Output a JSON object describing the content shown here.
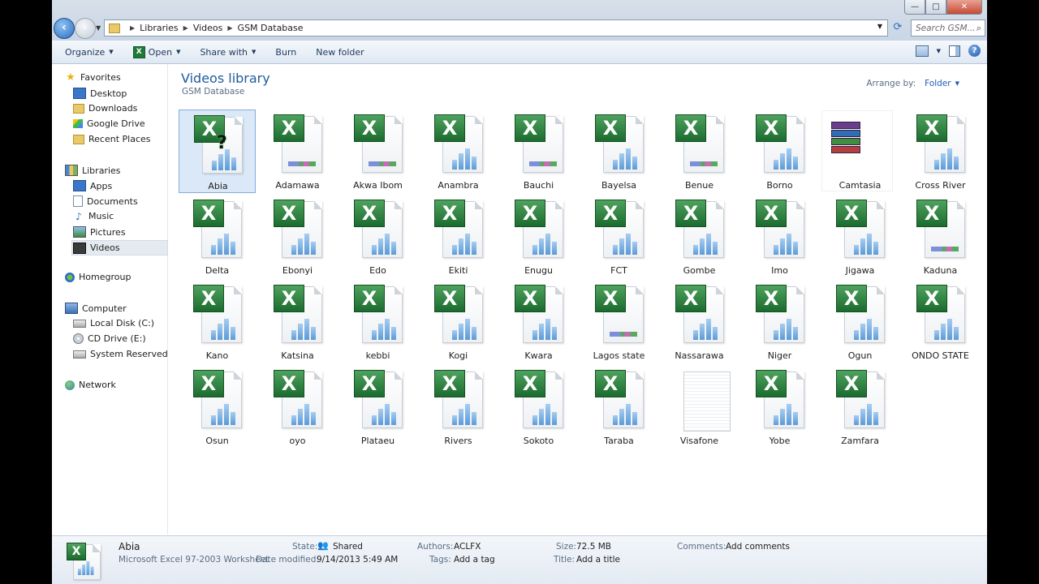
{
  "window": {
    "controls": {
      "minimize": "—",
      "maximize": "□",
      "close": "✕"
    }
  },
  "address": {
    "crumbs": [
      "Libraries",
      "Videos",
      "GSM Database"
    ],
    "search_placeholder": "Search GSM..."
  },
  "toolbar": {
    "organize": "Organize",
    "open": "Open",
    "share_with": "Share with",
    "burn": "Burn",
    "new_folder": "New folder"
  },
  "nav": {
    "favorites": "Favorites",
    "desktop": "Desktop",
    "downloads": "Downloads",
    "google_drive": "Google Drive",
    "recent_places": "Recent Places",
    "libraries": "Libraries",
    "apps": "Apps",
    "documents": "Documents",
    "music": "Music",
    "pictures": "Pictures",
    "videos": "Videos",
    "homegroup": "Homegroup",
    "computer": "Computer",
    "local_disk": "Local Disk (C:)",
    "cd_drive": "CD Drive (E:)",
    "system_reserved": "System Reserved (F:)",
    "network": "Network"
  },
  "content": {
    "title": "Videos library",
    "subtitle": "GSM Database",
    "arrange_label": "Arrange by:",
    "arrange_value": "Folder"
  },
  "files": [
    {
      "name": "Abia",
      "type": "excel-unknown",
      "selected": true
    },
    {
      "name": "Adamawa",
      "type": "excel-link"
    },
    {
      "name": "Akwa Ibom",
      "type": "excel-link"
    },
    {
      "name": "Anambra",
      "type": "excel"
    },
    {
      "name": "Bauchi",
      "type": "excel-link"
    },
    {
      "name": "Bayelsa",
      "type": "excel"
    },
    {
      "name": "Benue",
      "type": "excel-link"
    },
    {
      "name": "Borno",
      "type": "excel"
    },
    {
      "name": "Camtasia",
      "type": "archive"
    },
    {
      "name": "Cross River",
      "type": "excel"
    },
    {
      "name": "Delta",
      "type": "excel"
    },
    {
      "name": "Ebonyi",
      "type": "excel"
    },
    {
      "name": "Edo",
      "type": "excel"
    },
    {
      "name": "Ekiti",
      "type": "excel"
    },
    {
      "name": "Enugu",
      "type": "excel"
    },
    {
      "name": "FCT",
      "type": "excel"
    },
    {
      "name": "Gombe",
      "type": "excel"
    },
    {
      "name": "Imo",
      "type": "excel"
    },
    {
      "name": "Jigawa",
      "type": "excel"
    },
    {
      "name": "Kaduna",
      "type": "excel-link"
    },
    {
      "name": "Kano",
      "type": "excel"
    },
    {
      "name": "Katsina",
      "type": "excel"
    },
    {
      "name": "kebbi",
      "type": "excel"
    },
    {
      "name": "Kogi",
      "type": "excel"
    },
    {
      "name": "Kwara",
      "type": "excel"
    },
    {
      "name": "Lagos state",
      "type": "excel-link"
    },
    {
      "name": "Nassarawa",
      "type": "excel"
    },
    {
      "name": "Niger",
      "type": "excel"
    },
    {
      "name": "Ogun",
      "type": "excel"
    },
    {
      "name": "ONDO STATE",
      "type": "excel"
    },
    {
      "name": "Osun",
      "type": "excel"
    },
    {
      "name": "oyo",
      "type": "excel"
    },
    {
      "name": "Plataeu",
      "type": "excel"
    },
    {
      "name": "Rivers",
      "type": "excel"
    },
    {
      "name": "Sokoto",
      "type": "excel"
    },
    {
      "name": "Taraba",
      "type": "excel"
    },
    {
      "name": "Visafone",
      "type": "blank"
    },
    {
      "name": "Yobe",
      "type": "excel"
    },
    {
      "name": "Zamfara",
      "type": "excel"
    }
  ],
  "details": {
    "name": "Abia",
    "type": "Microsoft Excel 97-2003 Worksheet",
    "state_label": "State:",
    "state_value": "Shared",
    "date_label": "Date modified:",
    "date_value": "9/14/2013 5:49 AM",
    "authors_label": "Authors:",
    "authors_value": "ACLFX",
    "tags_label": "Tags:",
    "tags_value": "Add a tag",
    "size_label": "Size:",
    "size_value": "72.5 MB",
    "title_label": "Title:",
    "title_value": "Add a title",
    "comments_label": "Comments:",
    "comments_value": "Add comments"
  }
}
